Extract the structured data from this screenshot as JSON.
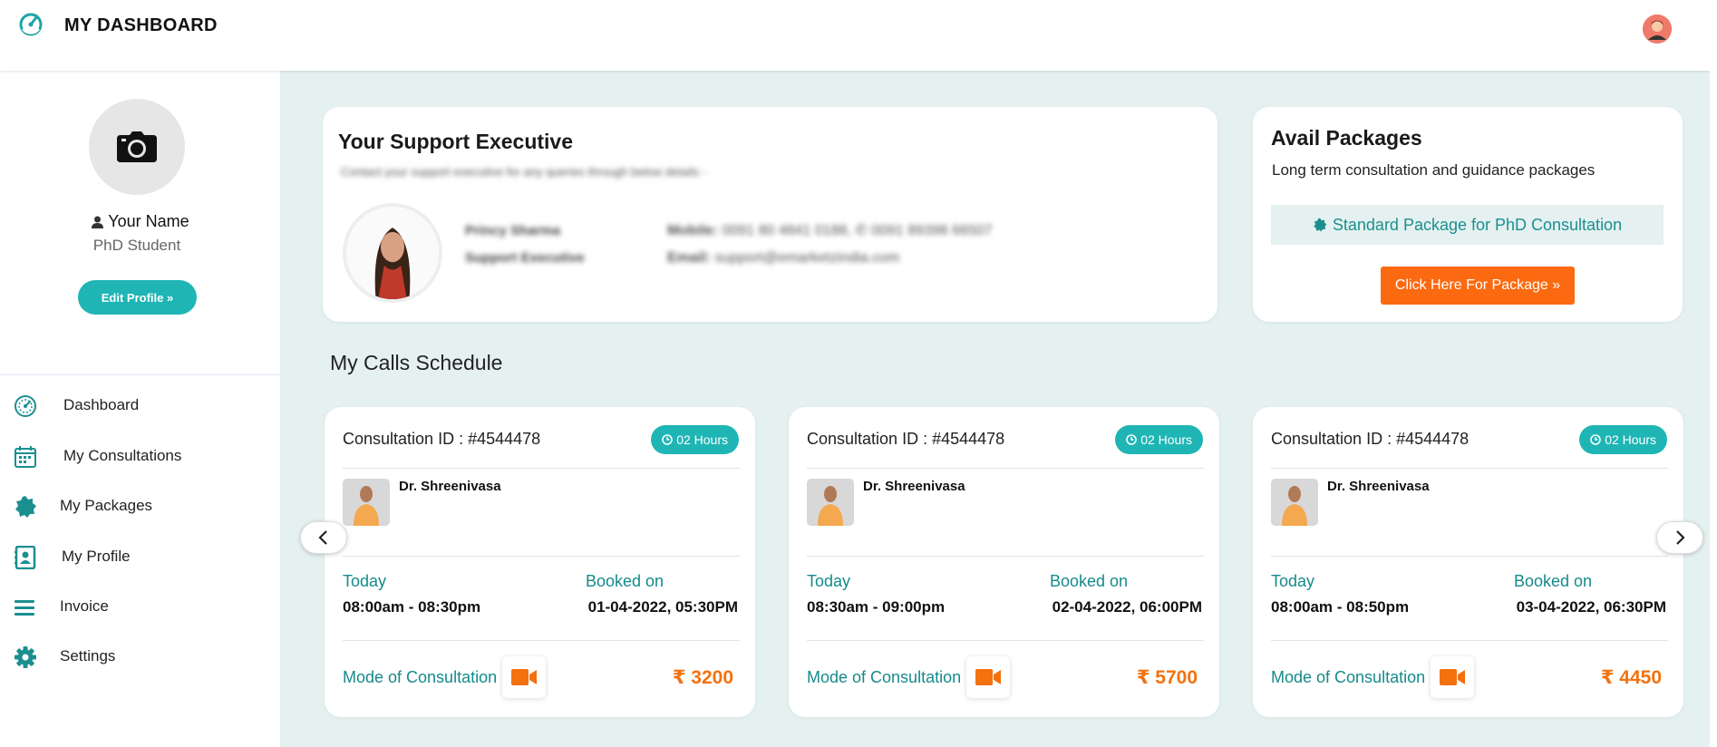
{
  "header": {
    "title": "MY DASHBOARD"
  },
  "profile": {
    "name": "Your Name",
    "role": "PhD Student",
    "edit_button": "Edit Profile »"
  },
  "sidebar": {
    "items": [
      {
        "label": "Dashboard",
        "icon": "dashboard-icon"
      },
      {
        "label": "My Consultations",
        "icon": "calendar-icon"
      },
      {
        "label": "My Packages",
        "icon": "badge-icon"
      },
      {
        "label": "My Profile",
        "icon": "contact-card-icon"
      },
      {
        "label": "Invoice",
        "icon": "list-icon"
      },
      {
        "label": "Settings",
        "icon": "gear-icon"
      }
    ]
  },
  "support": {
    "title": "Your Support Executive",
    "subtitle": "Contact your support executive for any queries through below details -",
    "exec_name": "Princy Sharma",
    "exec_role": "Support Executive",
    "mobile_label": "Mobile:",
    "mobile_value": "0091 80 4841 0188, ✆ 0091 89398 66507",
    "email_label": "Email:",
    "email_value": "support@emarketzindia.com"
  },
  "packages": {
    "title": "Avail Packages",
    "subtitle": "Long term consultation and guidance packages",
    "standard": "Standard Package for PhD Consultation",
    "cta": "Click Here For Package »"
  },
  "schedule": {
    "title": "My Calls Schedule",
    "calls": [
      {
        "id": "Consultation ID : #4544478",
        "duration": "02 Hours",
        "doctor": "Dr. Shreenivasa",
        "day_label": "Today",
        "time": "08:00am - 08:30pm",
        "booked_label": "Booked on",
        "booked_on": "01-04-2022, 05:30PM",
        "mode_label": "Mode of Consultation",
        "currency": "₹",
        "price": "3200"
      },
      {
        "id": "Consultation ID : #4544478",
        "duration": "02 Hours",
        "doctor": "Dr. Shreenivasa",
        "day_label": "Today",
        "time": "08:30am - 09:00pm",
        "booked_label": "Booked on",
        "booked_on": "02-04-2022, 06:00PM",
        "mode_label": "Mode of Consultation",
        "currency": "₹",
        "price": "5700"
      },
      {
        "id": "Consultation ID : #4544478",
        "duration": "02 Hours",
        "doctor": "Dr. Shreenivasa",
        "day_label": "Today",
        "time": "08:00am - 08:50pm",
        "booked_label": "Booked on",
        "booked_on": "03-04-2022, 06:30PM",
        "mode_label": "Mode of Consultation",
        "currency": "₹",
        "price": "4450"
      }
    ]
  },
  "colors": {
    "teal": "#1fb5b5",
    "teal_text": "#168a8a",
    "orange": "#f4710f",
    "background": "#e5f1f0"
  }
}
